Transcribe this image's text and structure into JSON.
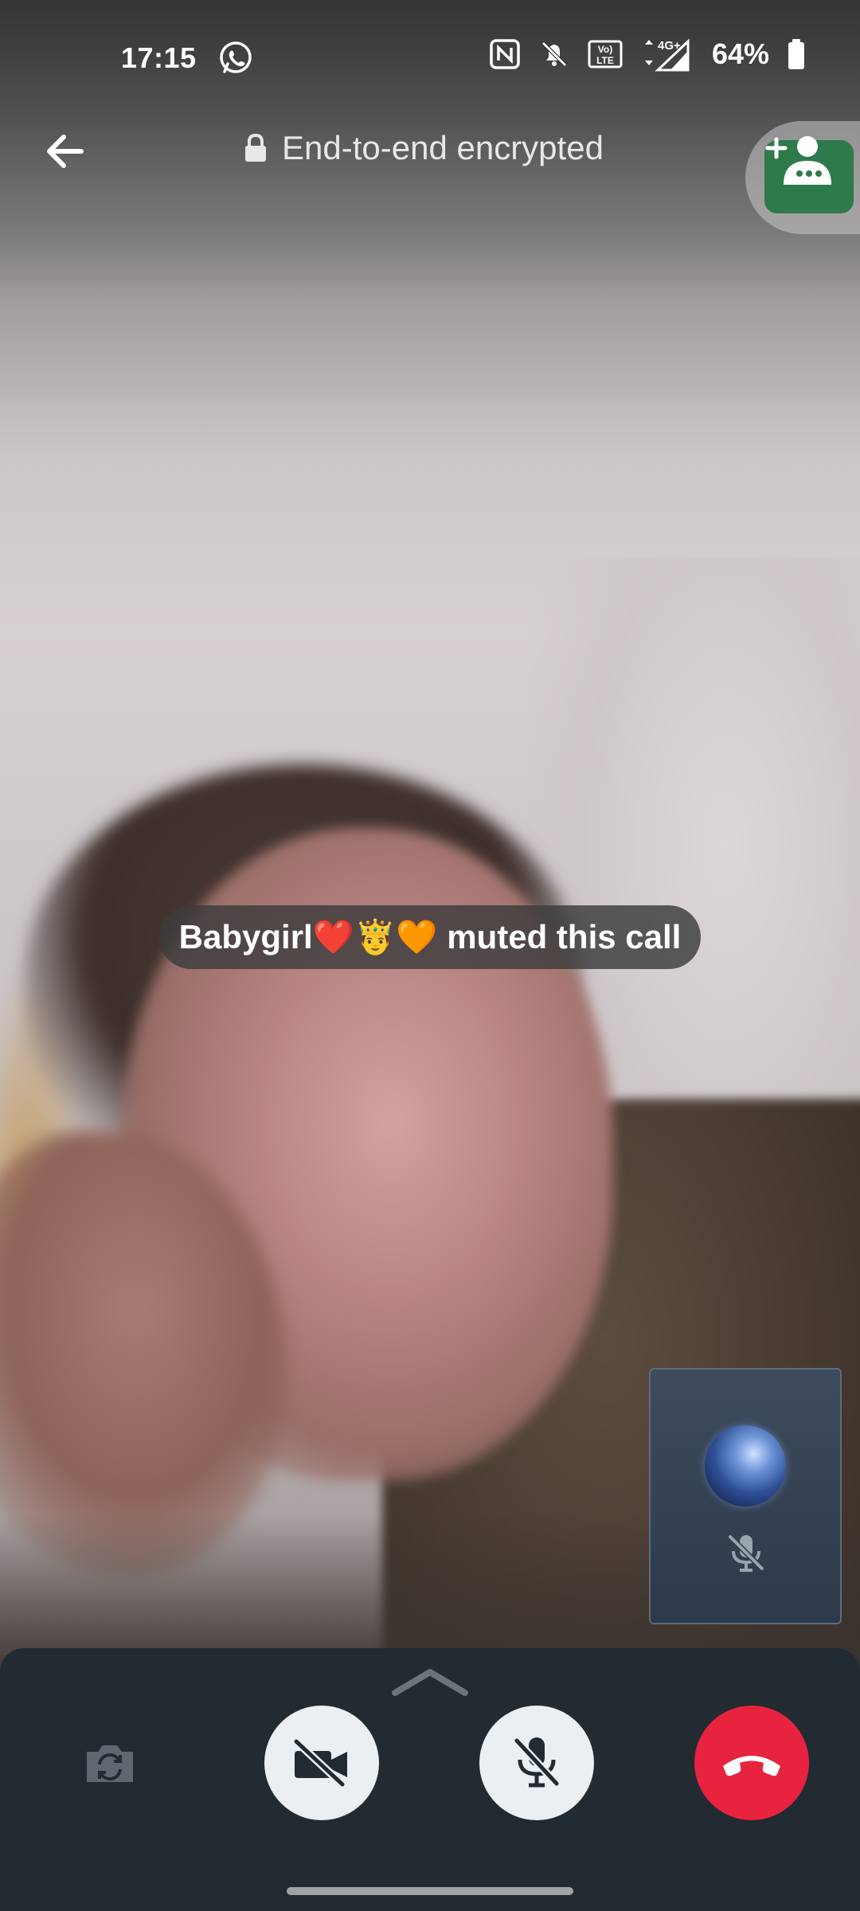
{
  "status_bar": {
    "time": "17:15",
    "battery": "64%",
    "icons": [
      "whatsapp-icon",
      "nfc-icon",
      "bell-off-icon",
      "volte-icon",
      "4g-signal-icon",
      "battery-icon"
    ]
  },
  "top_bar": {
    "encryption_label": "End-to-end encrypted",
    "back_icon": "arrow-left-icon",
    "lock_icon": "lock-icon",
    "add_participant_icon": "add-person-icon"
  },
  "toast": {
    "message": "Babygirl❤️🤴🧡 muted this call"
  },
  "self_view": {
    "mic_icon": "mic-off-icon"
  },
  "controls": {
    "expand_icon": "chevron-up-icon",
    "flip_camera_icon": "camera-flip-icon",
    "video_icon": "video-off-icon",
    "mic_icon": "mic-off-icon",
    "end_call_icon": "end-call-icon"
  },
  "colors": {
    "end_call": "#e8233f",
    "panel": "#222a32",
    "toggle_bg": "#eceff2",
    "add_participant_green": "#2f7a4a"
  }
}
